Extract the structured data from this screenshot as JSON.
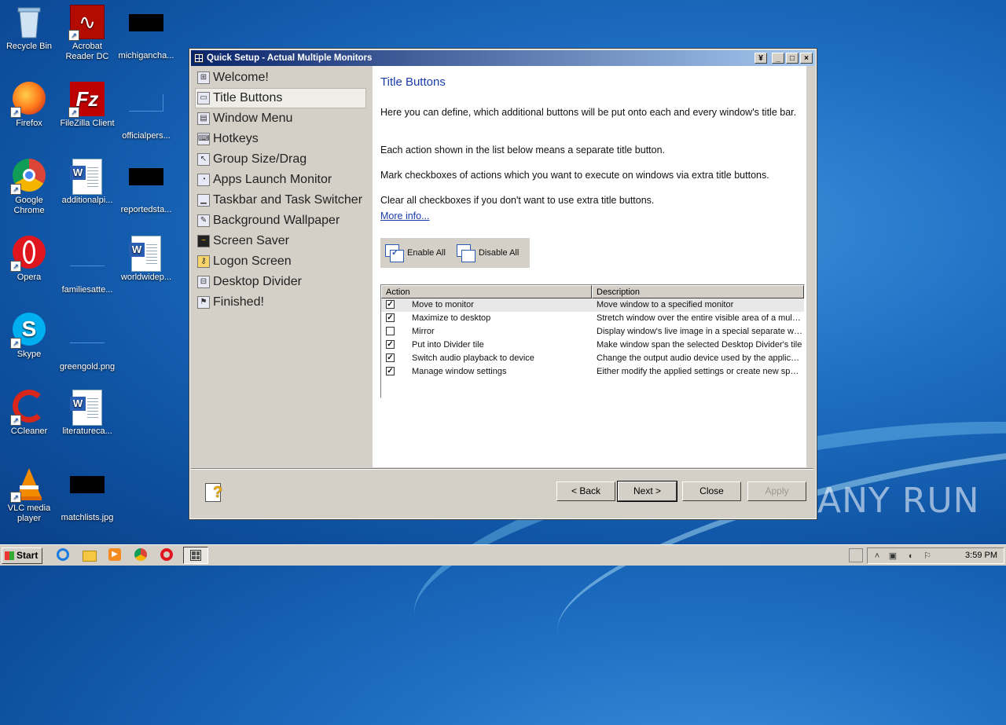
{
  "desktop": {
    "icons": [
      {
        "label": "Recycle Bin"
      },
      {
        "label": "Acrobat Reader DC"
      },
      {
        "label": "michigancha..."
      },
      {
        "label": "Firefox"
      },
      {
        "label": "FileZilla Client"
      },
      {
        "label": "officialpers..."
      },
      {
        "label": "Google Chrome"
      },
      {
        "label": "additionalpi..."
      },
      {
        "label": "reportedsta..."
      },
      {
        "label": "Opera"
      },
      {
        "label": "familiesatte..."
      },
      {
        "label": "worldwidep..."
      },
      {
        "label": "Skype"
      },
      {
        "label": "greengold.png"
      },
      {
        "label": "CCleaner"
      },
      {
        "label": "literatureca..."
      },
      {
        "label": "VLC media player"
      },
      {
        "label": "matchlists.jpg"
      }
    ],
    "watermark": "ANY RUN"
  },
  "window": {
    "title": "Quick Setup - Actual Multiple Monitors",
    "sidebar": [
      {
        "label": "Welcome!"
      },
      {
        "label": "Title Buttons"
      },
      {
        "label": "Window Menu"
      },
      {
        "label": "Hotkeys"
      },
      {
        "label": "Group Size/Drag"
      },
      {
        "label": "Apps Launch Monitor"
      },
      {
        "label": "Taskbar and Task Switcher"
      },
      {
        "label": "Background Wallpaper"
      },
      {
        "label": "Screen Saver"
      },
      {
        "label": "Logon Screen"
      },
      {
        "label": "Desktop Divider"
      },
      {
        "label": "Finished!"
      }
    ],
    "selected_item": "Title Buttons",
    "content": {
      "heading": "Title Buttons",
      "para1": "Here you can define, which additional buttons will be put onto each and every window's title bar.",
      "para2": "Each action shown in the list below means a separate title button.",
      "para3": "Mark checkboxes of actions which you want to execute on windows via extra title buttons.",
      "para4": "Clear all checkboxes if you don't want to use extra title buttons.",
      "more_info": "More info...",
      "enable_all": "Enable All",
      "disable_all": "Disable All",
      "columns": [
        "Action",
        "Description"
      ],
      "rows": [
        {
          "checked": true,
          "action": "Move to monitor",
          "description": "Move window to a specified monitor"
        },
        {
          "checked": true,
          "action": "Maximize to desktop",
          "description": "Stretch window over the entire visible area of a multi-..."
        },
        {
          "checked": false,
          "action": "Mirror",
          "description": "Display window's live image in a special separate wi..."
        },
        {
          "checked": true,
          "action": "Put into Divider tile",
          "description": "Make window span the selected Desktop Divider's tile"
        },
        {
          "checked": true,
          "action": "Switch audio playback to device",
          "description": "Change the output audio device used by the applica..."
        },
        {
          "checked": true,
          "action": "Manage window settings",
          "description": "Either modify the applied settings or create new spec..."
        }
      ]
    },
    "buttons": {
      "back": "< Back",
      "next": "Next >",
      "close": "Close",
      "apply": "Apply"
    }
  },
  "taskbar": {
    "start": "Start",
    "clock": "3:59 PM"
  }
}
